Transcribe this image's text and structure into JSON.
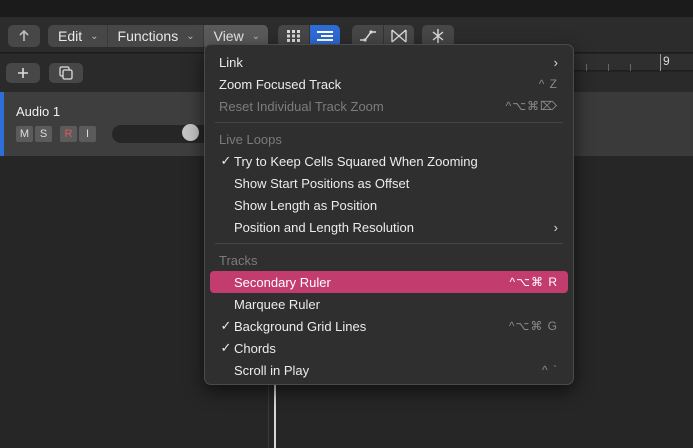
{
  "toolbar": {
    "menus": [
      {
        "label": "Edit"
      },
      {
        "label": "Functions"
      },
      {
        "label": "View"
      }
    ]
  },
  "track": {
    "name": "Audio 1",
    "buttons": [
      "M",
      "S",
      "R",
      "I"
    ]
  },
  "ruler": {
    "bar_number": "9"
  },
  "view_menu": {
    "items": [
      {
        "label": "Link",
        "shortcut": "",
        "submenu": true
      },
      {
        "label": "Zoom Focused Track",
        "shortcut": "^ Z"
      },
      {
        "label": "Reset Individual Track Zoom",
        "shortcut": "^⌥⌘⌦",
        "disabled": true
      }
    ],
    "section_live_loops": "Live Loops",
    "live_loops_items": [
      {
        "label": "Try to Keep Cells Squared When Zooming",
        "checked": true
      },
      {
        "label": "Show Start Positions as Offset"
      },
      {
        "label": "Show Length as Position"
      },
      {
        "label": "Position and Length Resolution",
        "submenu": true
      }
    ],
    "section_tracks": "Tracks",
    "tracks_items": [
      {
        "label": "Secondary Ruler",
        "shortcut": "^⌥⌘ R",
        "highlighted": true
      },
      {
        "label": "Marquee Ruler"
      },
      {
        "label": "Background Grid Lines",
        "shortcut": "^⌥⌘ G",
        "checked": true
      },
      {
        "label": "Chords",
        "checked": true
      },
      {
        "label": "Scroll in Play",
        "shortcut": "^ `"
      }
    ],
    "check_glyph": "✓",
    "arrow_glyph": "›"
  }
}
